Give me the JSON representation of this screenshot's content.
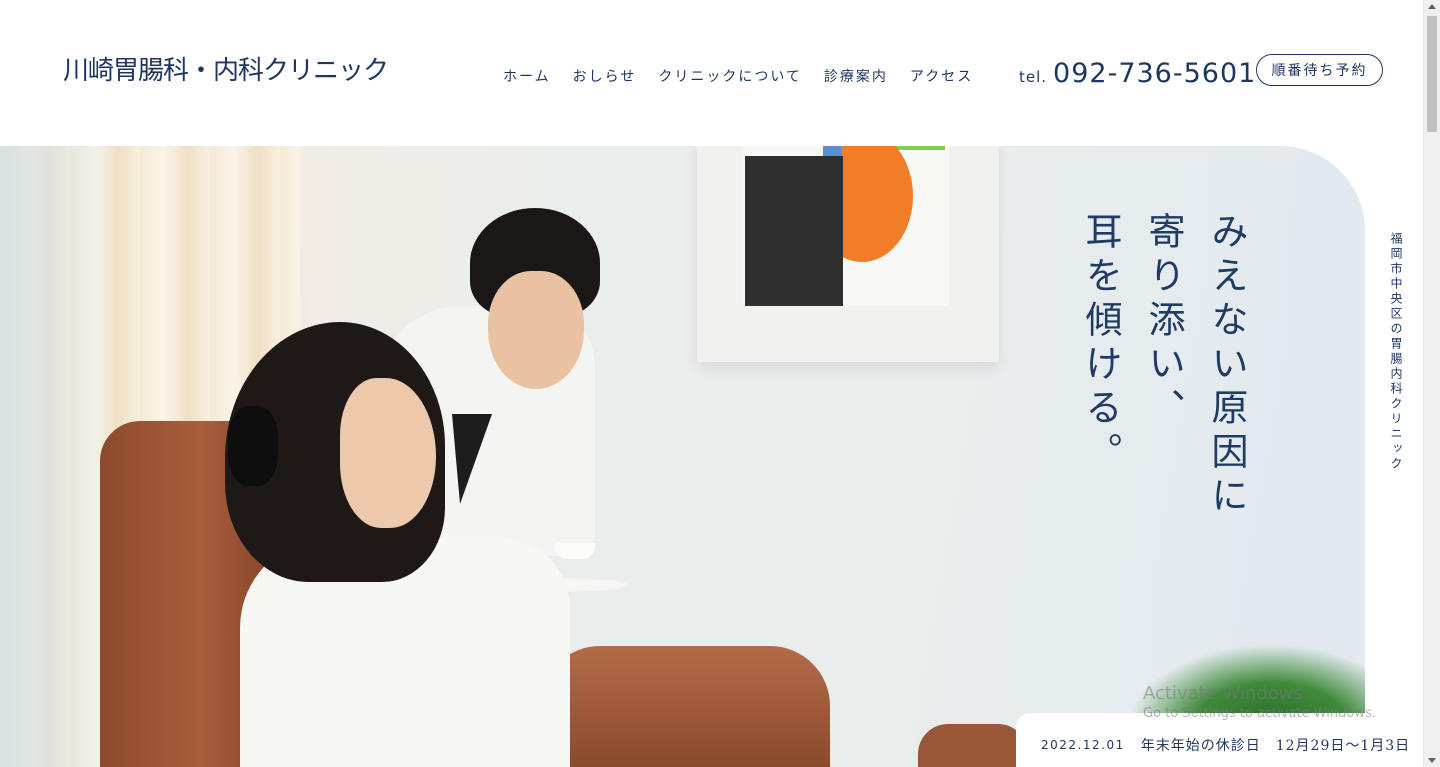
{
  "header": {
    "logo": "川崎胃腸科・内科クリニック",
    "nav": [
      "ホーム",
      "おしらせ",
      "クリニックについて",
      "診療案内",
      "アクセス"
    ],
    "tel_prefix": "tel.",
    "tel_number": "092-736-5601",
    "reserve_label": "順番待ち予約"
  },
  "hero": {
    "catch_lines": [
      "みえない原因に",
      "寄り添い、",
      "耳を傾ける。"
    ],
    "side_tagline": "福岡市中央区の胃腸内科クリニック"
  },
  "news": {
    "date": "2022.12.01",
    "title": "年末年始の休診日　12月29日〜1月3日"
  },
  "watermark": {
    "title": "Activate Windows",
    "subtitle": "Go to Settings to activate Windows."
  }
}
